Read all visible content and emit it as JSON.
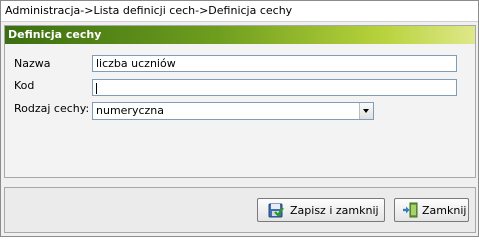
{
  "breadcrumb": "Administracja->Lista definicji cech->Definicja cechy",
  "panel": {
    "title": "Definicja cechy"
  },
  "form": {
    "name_label": "Nazwa",
    "name_value": "liczba uczniów",
    "code_label": "Kod",
    "code_value": "",
    "type_label": "Rodzaj cechy:",
    "type_value": "numeryczna"
  },
  "buttons": {
    "save_close": "Zapisz i zamknij",
    "close": "Zamknij"
  },
  "icons": {
    "save": "save-icon",
    "close": "exit-icon",
    "dropdown": "chevron-down-icon"
  },
  "colors": {
    "header_start": "#3a6e10",
    "header_end": "#dfe88a"
  }
}
